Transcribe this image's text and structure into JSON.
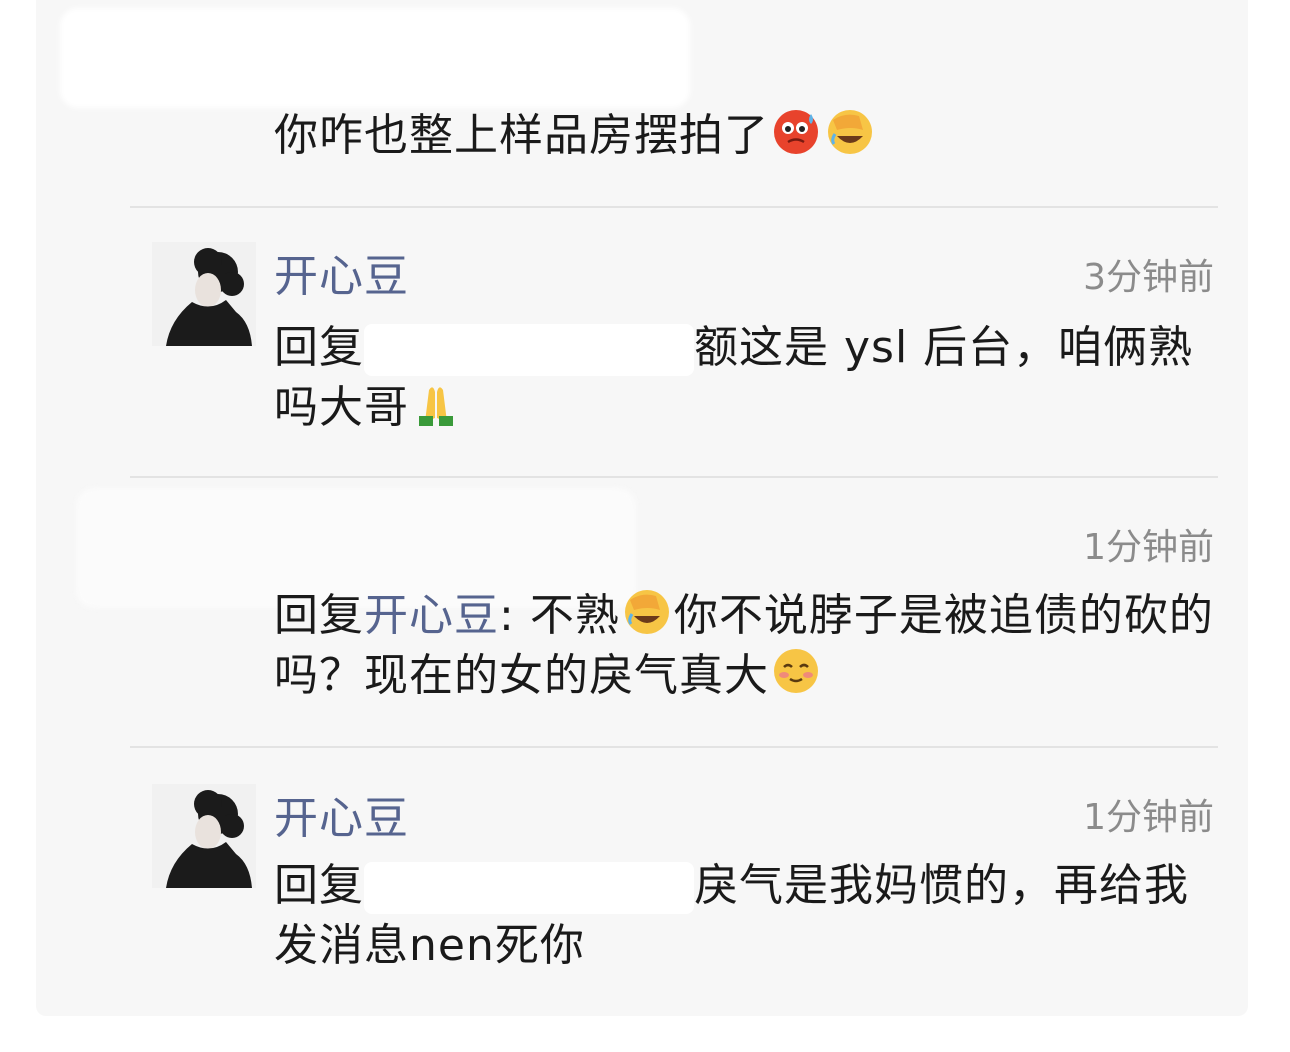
{
  "comments": [
    {
      "text": "你咋也整上样品房摆拍了",
      "emojis": [
        "hot-face-emoji",
        "facepalm-laugh-emoji"
      ]
    },
    {
      "author": "开心豆",
      "time": "3分钟前",
      "reply_prefix": "回复",
      "text": "额这是 ysl 后台，咱俩熟吗大哥",
      "emojis": [
        "pray-emoji"
      ]
    },
    {
      "time": "1分钟前",
      "reply_prefix": "回复",
      "mention": "开心豆",
      "separator": ":",
      "text_part1": " 不熟",
      "text_part2": "你不说脖子是被追债的砍的吗？现在的女的戾气真大",
      "emojis": [
        "facepalm-laugh-emoji",
        "blush-emoji"
      ]
    },
    {
      "author": "开心豆",
      "time": "1分钟前",
      "reply_prefix": "回复",
      "text": "戾气是我妈惯的，再给我发消息nen死你"
    }
  ],
  "colors": {
    "author_blue": "#56648f",
    "time_gray": "#8b8b8b",
    "panel_bg": "#f7f7f7"
  }
}
